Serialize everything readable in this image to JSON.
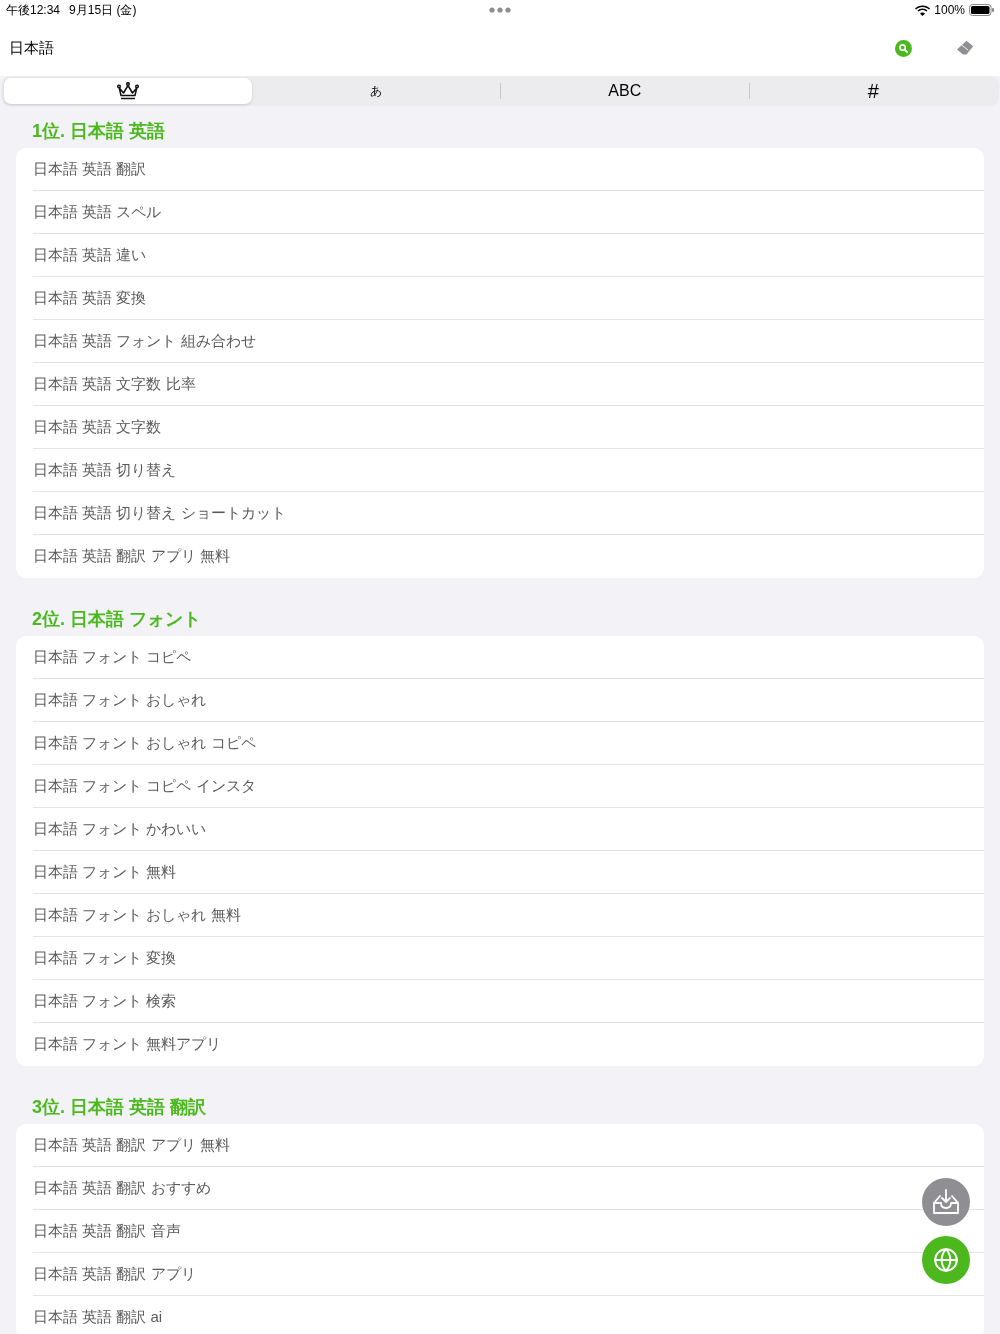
{
  "status_bar": {
    "time": "午後12:34",
    "date": "9月15日 (金)",
    "battery": "100%"
  },
  "nav_bar": {
    "title": "日本語"
  },
  "tabs": [
    {
      "kind": "icon",
      "selected": true
    },
    {
      "kind": "text",
      "label": "あ",
      "selected": false
    },
    {
      "kind": "text",
      "label": "ABC",
      "selected": false
    },
    {
      "kind": "text",
      "label": "#",
      "selected": false
    }
  ],
  "sections": [
    {
      "title": "1位. 日本語 英語",
      "items": [
        "日本語 英語 翻訳",
        "日本語 英語 スペル",
        "日本語 英語 違い",
        "日本語 英語 変換",
        "日本語 英語 フォント 組み合わせ",
        "日本語 英語 文字数 比率",
        "日本語 英語 文字数",
        "日本語 英語 切り替え",
        "日本語 英語 切り替え ショートカット",
        "日本語 英語 翻訳 アプリ 無料"
      ]
    },
    {
      "title": "2位. 日本語 フォント",
      "items": [
        "日本語 フォント コピペ",
        "日本語 フォント おしゃれ",
        "日本語 フォント おしゃれ コピペ",
        "日本語 フォント コピペ インスタ",
        "日本語 フォント かわいい",
        "日本語 フォント 無料",
        "日本語 フォント おしゃれ 無料",
        "日本語 フォント 変換",
        "日本語 フォント 検索",
        "日本語 フォント 無料アプリ"
      ]
    },
    {
      "title": "3位. 日本語 英語 翻訳",
      "items": [
        "日本語 英語 翻訳 アプリ 無料",
        "日本語 英語 翻訳 おすすめ",
        "日本語 英語 翻訳 音声",
        "日本語 英語 翻訳 アプリ",
        "日本語 英語 翻訳 ai"
      ]
    }
  ]
}
